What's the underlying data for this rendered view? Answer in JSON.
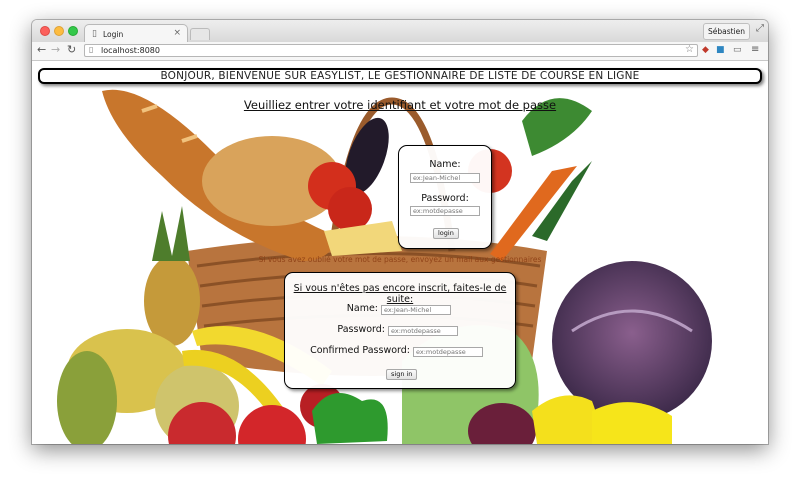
{
  "browser": {
    "tab_title": "Login",
    "tab_close": "×",
    "profile_name": "Sébastien",
    "url": "localhost:8080"
  },
  "page": {
    "banner": "BONJOUR, BIENVENUE SUR EASYLIST, LE GESTIONNAIRE DE LISTE DE COURSE EN LIGNE",
    "subtitle": "Veuilliez entrer votre identifiant et votre mot de passe",
    "login": {
      "name_label": "Name:",
      "name_placeholder": "ex:Jean-Michel",
      "password_label": "Password:",
      "password_placeholder": "ex:motdepasse",
      "button": "login"
    },
    "forgot_text": "Si vous avez oublié votre mot de passe, envoyez un mail aux gestionnaires",
    "signup": {
      "title": "Si vous n'êtes pas encore inscrit, faites-le de suite:",
      "name_label": "Name:",
      "name_placeholder": "ex:Jean-Michel",
      "password_label": "Password:",
      "password_placeholder": "ex:motdepasse",
      "confirm_label": "Confirmed Password:",
      "confirm_placeholder": "ex:motdepasse",
      "button": "sign in"
    }
  }
}
